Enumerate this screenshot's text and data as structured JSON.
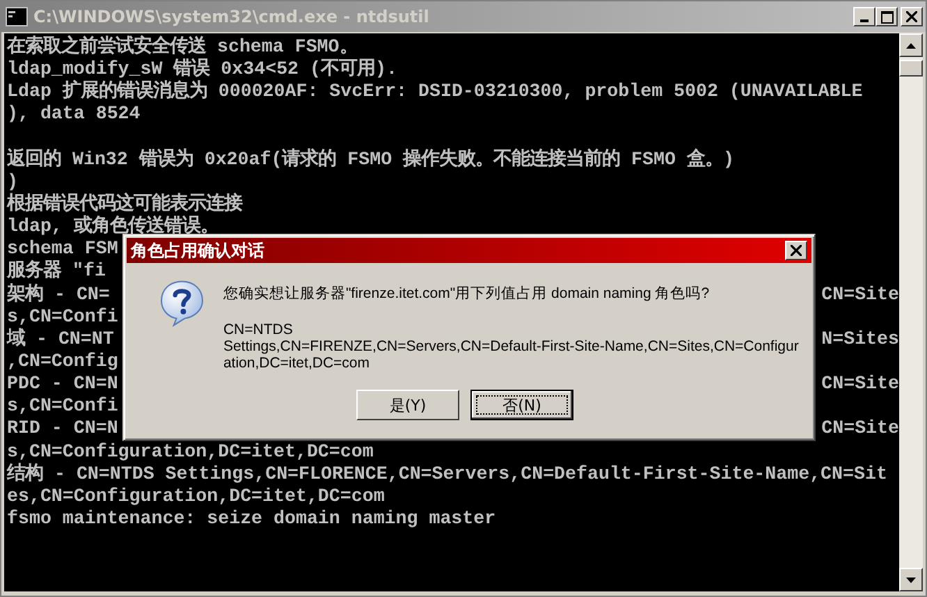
{
  "window": {
    "title": "C:\\WINDOWS\\system32\\cmd.exe - ntdsutil",
    "active": false
  },
  "console": {
    "paragraphs": [
      [
        {
          "text": "在索取之前尝试安全传送 schema FSMO。"
        },
        {
          "text": "ldap_modify_sW 错误 0x34<52 (不可用)."
        },
        {
          "text": "Ldap 扩展的错误消息为 000020AF: SvcErr: DSID-03210300, problem 5002 (UNAVAILABLE"
        },
        {
          "text": "), data 8524"
        }
      ],
      [
        {
          "text": "返回的 Win32 错误为 0x20af(请求的 FSMO 操作失败。不能连接当前的 FSMO 盒。)"
        },
        {
          "text": ")"
        },
        {
          "text": "根据错误代码这可能表示连接"
        },
        {
          "text": "ldap, 或角色传送错误。"
        },
        {
          "text": "schema FSM"
        },
        {
          "text": "服务器 \"fi"
        },
        {
          "text": "架构 - CN=",
          "right": "CN=Site"
        },
        {
          "text": "s,CN=Confi"
        },
        {
          "text": "域 - CN=NT",
          "right": "N=Sites"
        },
        {
          "text": ",CN=Config"
        },
        {
          "text": "PDC - CN=N",
          "right": "CN=Site"
        },
        {
          "text": "s,CN=Confi"
        },
        {
          "text": "RID - CN=N",
          "right": "CN=Site"
        },
        {
          "text": "s,CN=Configuration,DC=itet,DC=com"
        },
        {
          "text": "结构 - CN=NTDS Settings,CN=FLORENCE,CN=Servers,CN=Default-First-Site-Name,CN=Sit"
        },
        {
          "text": "es,CN=Configuration,DC=itet,DC=com"
        },
        {
          "text": "fsmo maintenance: seize domain naming master"
        }
      ]
    ]
  },
  "dialog": {
    "title": "角色占用确认对话",
    "active": true,
    "message": "您确实想让服务器\"firenze.itet.com\"用下列值占用 domain naming 角色吗?",
    "detail_lines": [
      "CN=NTDS",
      "Settings,CN=FIRENZE,CN=Servers,CN=Default-First-Site-Name,CN=Sites,CN=Configur",
      "ation,DC=itet,DC=com"
    ],
    "buttons": [
      {
        "label": "是(Y)",
        "focused": false
      },
      {
        "label": "否(N)",
        "focused": true
      }
    ]
  }
}
